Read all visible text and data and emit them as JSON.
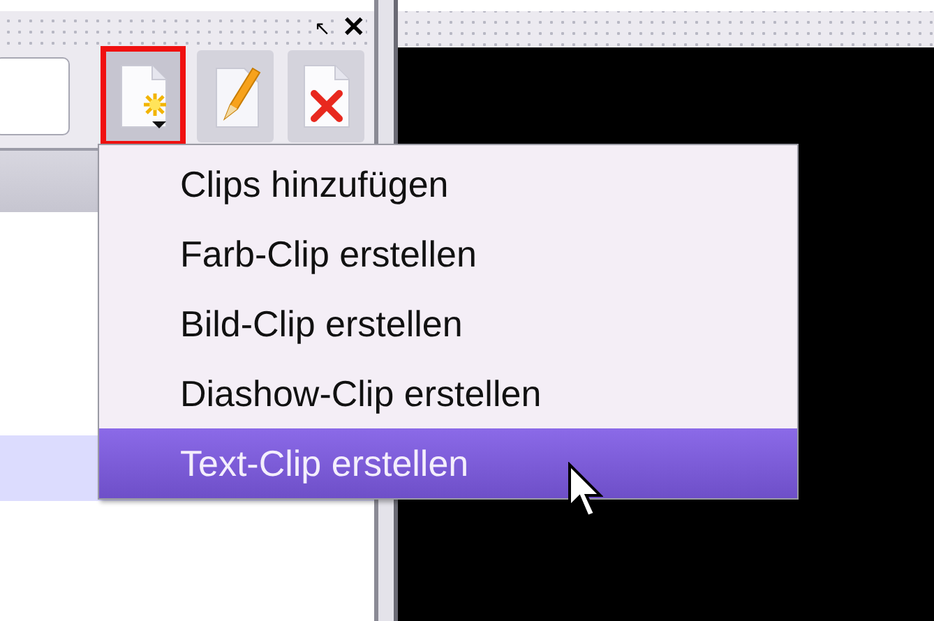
{
  "dock": {
    "float_glyph": "↖",
    "close_glyph": "✕"
  },
  "toolbar": {
    "buttons": [
      {
        "kind": "new",
        "active": true
      },
      {
        "kind": "edit",
        "active": false
      },
      {
        "kind": "delete",
        "active": false
      }
    ]
  },
  "clip_list": {
    "rows": [
      {
        "selected": false
      },
      {
        "selected": true
      }
    ]
  },
  "menu": {
    "items": [
      {
        "label": "Clips hinzufügen",
        "selected": false
      },
      {
        "label": "Farb-Clip erstellen",
        "selected": false
      },
      {
        "label": "Bild-Clip erstellen",
        "selected": false
      },
      {
        "label": "Diashow-Clip erstellen",
        "selected": false
      },
      {
        "label": "Text-Clip erstellen",
        "selected": true
      }
    ]
  }
}
